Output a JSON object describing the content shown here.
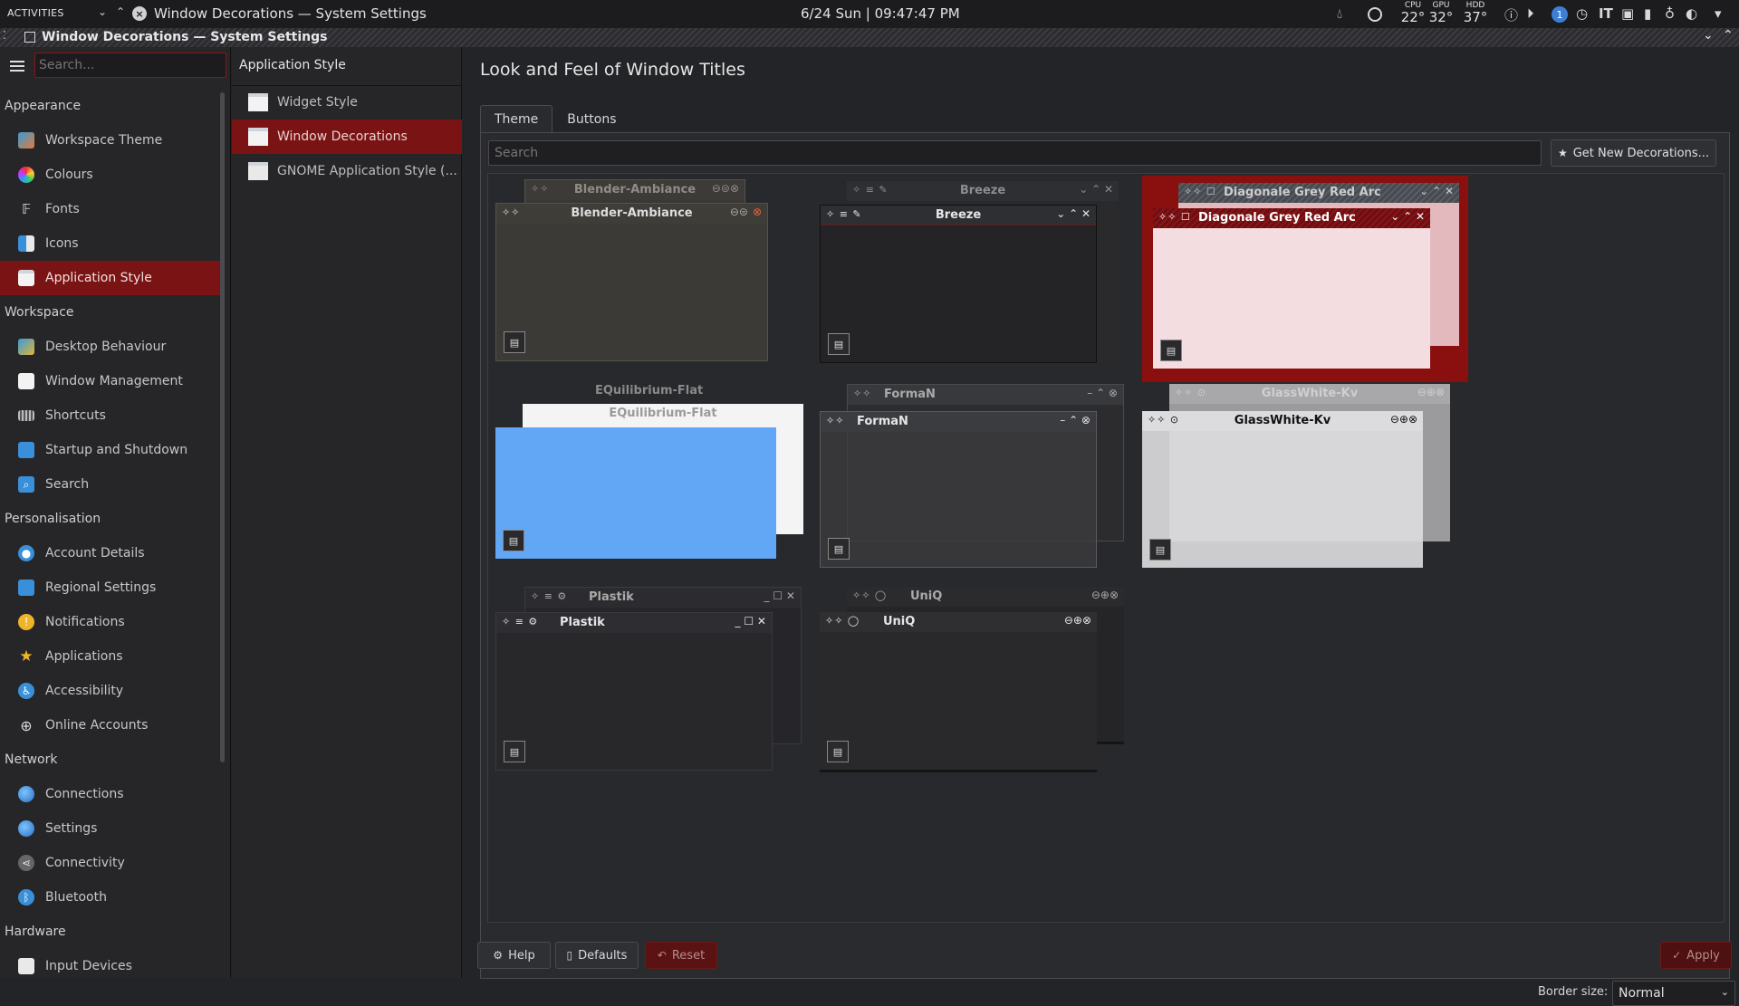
{
  "topbar": {
    "activities": "ACTIVITIES",
    "window_title": "Window Decorations — System Settings",
    "clock": "6/24 Sun | 09:47:47 PM",
    "sensors": [
      {
        "label": "CPU",
        "value": "22°"
      },
      {
        "label": "GPU",
        "value": "32°"
      },
      {
        "label": "HDD",
        "value": "37°"
      }
    ]
  },
  "titlebar": {
    "text": "Window Decorations — System Settings"
  },
  "sidebar": {
    "search_placeholder": "Search...",
    "categories": [
      {
        "name": "Appearance",
        "items": [
          "Workspace Theme",
          "Colours",
          "Fonts",
          "Icons",
          "Application Style"
        ]
      },
      {
        "name": "Workspace",
        "items": [
          "Desktop Behaviour",
          "Window Management",
          "Shortcuts",
          "Startup and Shutdown",
          "Search"
        ]
      },
      {
        "name": "Personalisation",
        "items": [
          "Account Details",
          "Regional Settings",
          "Notifications",
          "Applications",
          "Accessibility",
          "Online Accounts"
        ]
      },
      {
        "name": "Network",
        "items": [
          "Connections",
          "Settings",
          "Connectivity",
          "Bluetooth"
        ]
      },
      {
        "name": "Hardware",
        "items": [
          "Input Devices"
        ]
      }
    ],
    "active_item": "Application Style"
  },
  "middle": {
    "header": "Application Style",
    "items": [
      "Widget Style",
      "Window Decorations",
      "GNOME Application Style (..."
    ],
    "active_item": "Window Decorations"
  },
  "main": {
    "title": "Look and Feel of Window Titles",
    "tabs": [
      "Theme",
      "Buttons"
    ],
    "active_tab": "Theme",
    "search_placeholder": "Search",
    "get_new_label": "Get New Decorations...",
    "decorations": [
      "Blender-Ambiance",
      "Breeze",
      "Diagonale Grey Red Arc",
      "EQuilibrium-Flat",
      "FormaN",
      "GlassWhite-Kv",
      "Plastik",
      "UniQ"
    ],
    "selected_decoration": "Diagonale Grey Red Arc",
    "border_size_label": "Border size:",
    "border_size_value": "Normal"
  },
  "buttons": {
    "help": "Help",
    "defaults": "Defaults",
    "reset": "Reset",
    "apply": "Apply"
  },
  "colors": {
    "accent": "#7a1414",
    "background": "#232427",
    "selected_preview": "#8a1010",
    "equilibrium_blue": "#62a6f6"
  }
}
